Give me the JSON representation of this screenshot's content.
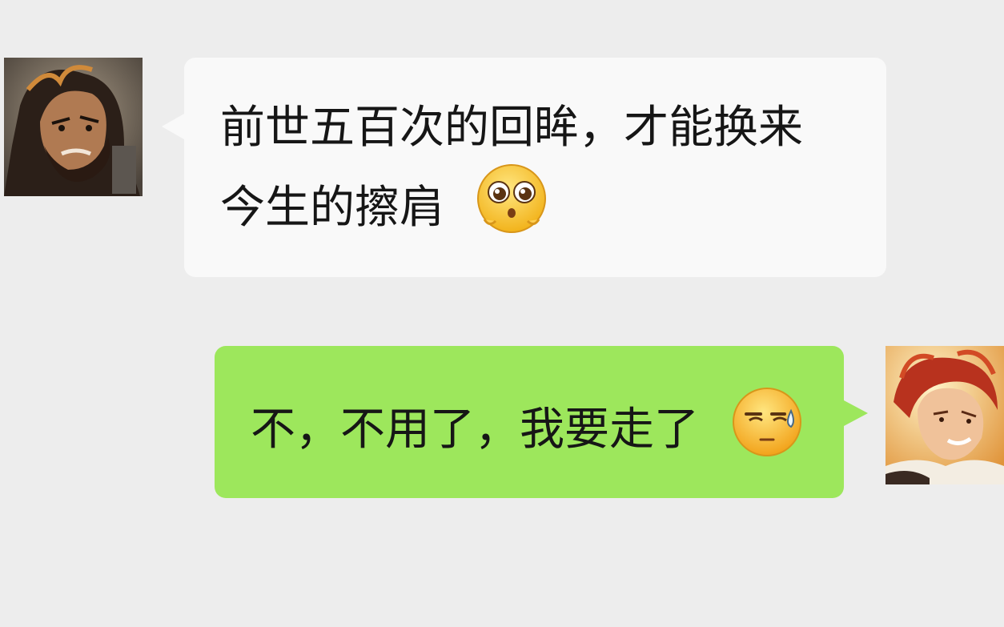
{
  "messages": [
    {
      "side": "incoming",
      "line1": "前世五百次的回眸，才能换来",
      "line2": "今生的擦肩",
      "emoji": "pleading-face-emoji",
      "avatar": "bearded-warrior-avatar"
    },
    {
      "side": "outgoing",
      "text": "不，不用了，我要走了",
      "emoji": "awkward-sweat-emoji",
      "avatar": "red-haired-hero-avatar"
    }
  ],
  "colors": {
    "background": "#ededed",
    "incoming_bubble": "#f9f9f9",
    "outgoing_bubble": "#9de75c",
    "text": "#161616"
  }
}
